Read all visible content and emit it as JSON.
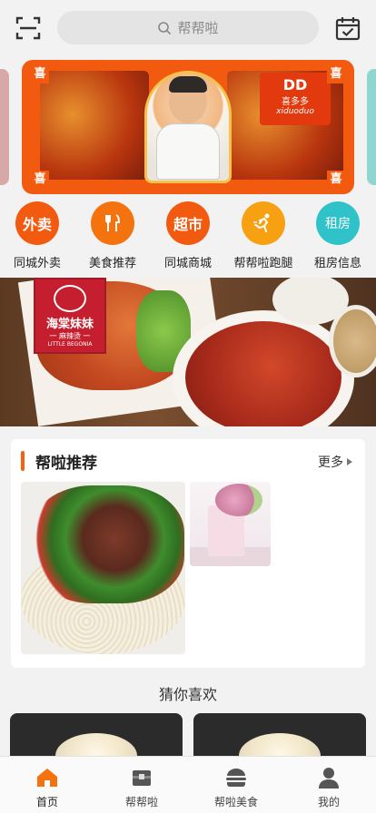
{
  "header": {
    "search_placeholder": "帮帮啦"
  },
  "banner": {
    "corner_char": "喜",
    "brand_mark": "DD",
    "brand_name": "喜多多",
    "brand_en": "xiduoduo"
  },
  "services": [
    {
      "icon_text": "外卖",
      "label": "同城外卖",
      "color": "#f25a10"
    },
    {
      "icon_text": "",
      "label": "美食推荐",
      "color": "#f4730f"
    },
    {
      "icon_text": "超市",
      "label": "同城商城",
      "color": "#f25a10"
    },
    {
      "icon_text": "",
      "label": "帮帮啦跑腿",
      "color": "#f7a012"
    },
    {
      "icon_text": "租房",
      "label": "租房信息",
      "color": "#2fc2c8"
    }
  ],
  "promo": {
    "brand_name": "海棠妹妹",
    "brand_sub": "一 麻辣烫 一",
    "brand_en": "LITTLE BEGONIA"
  },
  "recommend": {
    "title": "帮啦推荐",
    "more": "更多"
  },
  "guess": {
    "title": "猜你喜欢"
  },
  "tabs": [
    {
      "label": "首页",
      "active": true
    },
    {
      "label": "帮帮啦",
      "active": false
    },
    {
      "label": "帮啦美食",
      "active": false
    },
    {
      "label": "我的",
      "active": false
    }
  ],
  "colors": {
    "accent": "#f25a10",
    "teal": "#2fc2c8"
  }
}
